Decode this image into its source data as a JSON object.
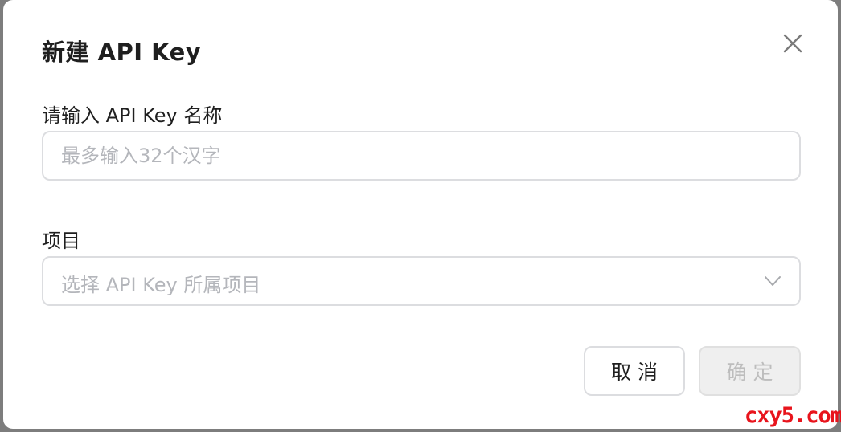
{
  "dialog": {
    "title": "新建 API Key",
    "close_icon": "close-icon"
  },
  "form": {
    "name_field": {
      "label": "请输入 API Key 名称",
      "placeholder": "最多输入32个汉字",
      "value": ""
    },
    "project_field": {
      "label": "项目",
      "placeholder": "选择 API Key 所属项目",
      "icon": "chevron-down-icon"
    }
  },
  "actions": {
    "cancel_label": "取消",
    "confirm_label": "确定",
    "confirm_disabled": true
  },
  "watermark": "cxy5.com",
  "colors": {
    "border": "#dcdde0",
    "placeholder": "#b4b6bb",
    "disabled_bg": "#efefef",
    "watermark": "#e8141c"
  }
}
